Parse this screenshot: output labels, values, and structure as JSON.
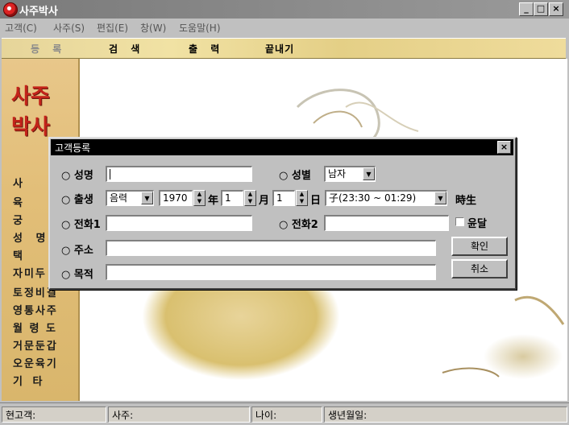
{
  "window": {
    "title": "사주박사"
  },
  "menu": [
    "고객(C)",
    "사주(S)",
    "편집(E)",
    "창(W)",
    "도움말(H)"
  ],
  "toolbar": [
    "등 록",
    "검 색",
    "출 력",
    "끝내기"
  ],
  "sidebar": {
    "logo_top": "사주",
    "logo_bottom": "박사",
    "items": [
      "사",
      "육",
      "궁",
      "성 명",
      "택",
      "자미두",
      "토정비결",
      "영통사주",
      "월 령 도",
      "거문둔갑",
      "오운육기",
      "기 타"
    ]
  },
  "dialog": {
    "title": "고객등록",
    "name_label": "성명",
    "name_value": "",
    "gender_label": "성별",
    "gender_value": "남자",
    "birth_label": "출생",
    "calendar_value": "음력",
    "year_value": "1970",
    "year_unit": "年",
    "month_value": "1",
    "month_unit": "月",
    "day_value": "1",
    "day_unit": "日",
    "hour_value": "子(23:30 ~ 01:29)",
    "hour_unit": "時生",
    "phone1_label": "전화1",
    "phone1_value": "",
    "phone2_label": "전화2",
    "phone2_value": "",
    "leap_label": "윤달",
    "address_label": "주소",
    "address_value": "",
    "purpose_label": "목적",
    "purpose_value": "",
    "ok_label": "확인",
    "cancel_label": "취소"
  },
  "status": {
    "current_customer": "현고객:",
    "saju": "사주:",
    "age": "나이:",
    "birthday": "생년월일:"
  }
}
